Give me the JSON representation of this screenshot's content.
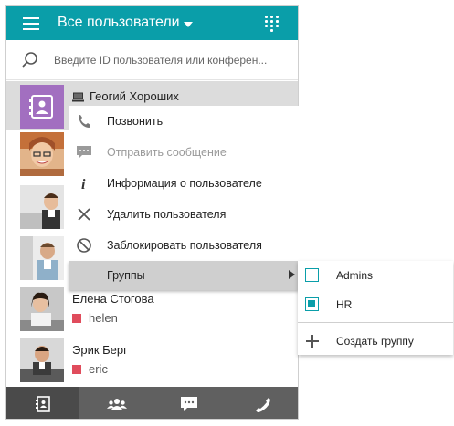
{
  "header": {
    "title": "Все пользователи"
  },
  "search": {
    "placeholder": "Введите ID пользователя или конферен..."
  },
  "contacts": [
    {
      "name": "Геогий Хороших"
    },
    {
      "name": ""
    },
    {
      "name": ""
    },
    {
      "name": ""
    },
    {
      "name": "Елена Стогова",
      "login": "helen",
      "status_color": "#e04c5c"
    },
    {
      "name": "Эрик Берг",
      "login": "eric",
      "status_color": "#e04c5c"
    }
  ],
  "context_menu": {
    "items": [
      {
        "label": "Позвонить",
        "icon": "phone-icon"
      },
      {
        "label": "Отправить сообщение",
        "icon": "chat-icon",
        "disabled": true
      },
      {
        "label": "Информация о пользователе",
        "icon": "info-icon"
      },
      {
        "label": "Удалить пользователя",
        "icon": "close-icon"
      },
      {
        "label": "Заблокировать пользователя",
        "icon": "block-icon"
      },
      {
        "label": "Группы",
        "icon": "chevron-right-icon"
      }
    ]
  },
  "groups_submenu": {
    "items": [
      {
        "label": "Admins",
        "checked": false
      },
      {
        "label": "HR",
        "checked": true
      }
    ],
    "create_label": "Создать группу"
  },
  "bottom_tabs": [
    {
      "name": "contacts",
      "icon": "address-book-icon",
      "active": true
    },
    {
      "name": "groups",
      "icon": "group-icon",
      "active": false
    },
    {
      "name": "chats",
      "icon": "chat-icon",
      "active": false
    },
    {
      "name": "calls",
      "icon": "phone-icon",
      "active": false
    }
  ],
  "colors": {
    "accent": "#0a9ea9",
    "bottom_bar": "#606060",
    "status_offline": "#e04c5c"
  }
}
